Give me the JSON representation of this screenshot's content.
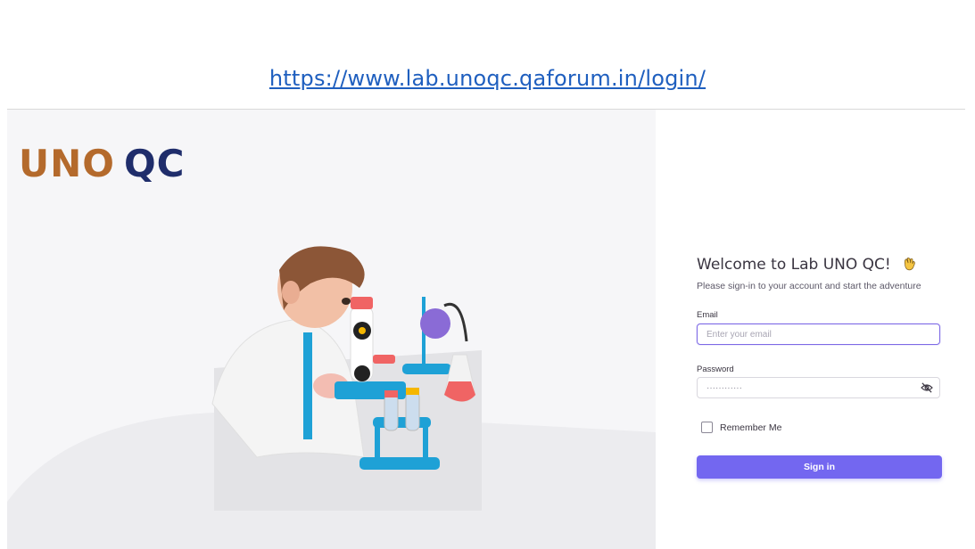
{
  "caption": {
    "url": "https://www.lab.unoqc.qaforum.in/login/"
  },
  "brand": {
    "part1": "UNO",
    "part2": "QC",
    "colors": {
      "uno": "#b46a2c",
      "qc": "#1f2d6b"
    }
  },
  "illustration": {
    "subject": "scientist-with-microscope-illustration"
  },
  "login": {
    "title": "Welcome to Lab UNO QC!",
    "title_icon": "waving-hand-icon",
    "subtitle": "Please sign-in to your account and start the adventure",
    "email": {
      "label": "Email",
      "placeholder": "Enter your email",
      "value": ""
    },
    "password": {
      "label": "Password",
      "value": "············",
      "toggle_icon": "eye-off-icon"
    },
    "remember_label": "Remember Me",
    "remember_checked": false,
    "submit_label": "Sign in",
    "accent_color": "#7367f0"
  }
}
